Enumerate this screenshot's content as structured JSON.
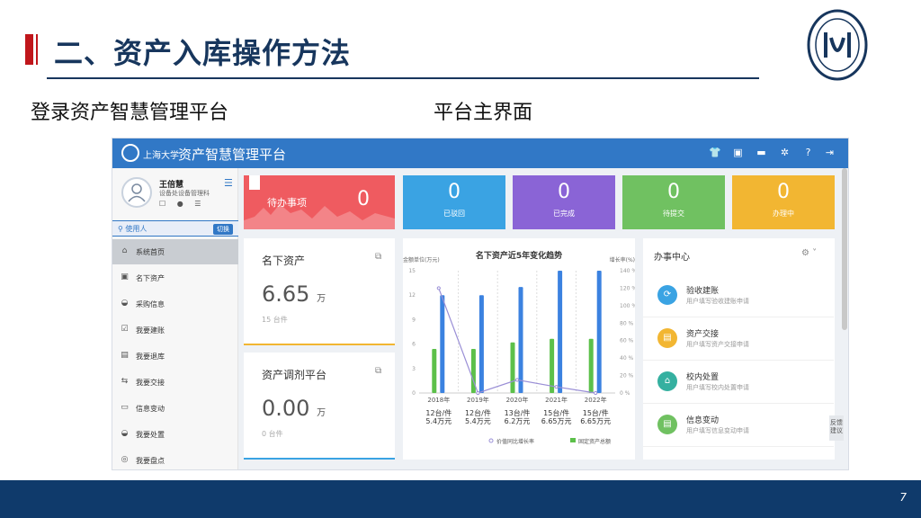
{
  "slide": {
    "title": "二、资产入库操作方法",
    "subtitle_left": "登录资产智慧管理平台",
    "subtitle_right": "平台主界面",
    "page_number": "7",
    "logo_text": "上海大学 SHANGHAI UNIVERSITY"
  },
  "app": {
    "brand": "上海大学",
    "title": "资产智慧管理平台",
    "top_icons": [
      "shirt-icon",
      "box-icon",
      "message-icon",
      "bug-icon",
      "help-icon",
      "logout-icon"
    ],
    "user": {
      "name": "王倍慧",
      "dept": "设备处设备管理科",
      "icons": "☐ ● ☰"
    },
    "role": {
      "label": "使用人",
      "switch": "切换"
    },
    "menu": [
      {
        "label": "系统首页",
        "icon": "⌂"
      },
      {
        "label": "名下资产",
        "icon": "▣"
      },
      {
        "label": "采购信息",
        "icon": "◒"
      },
      {
        "label": "我要建账",
        "icon": "☑"
      },
      {
        "label": "我要退库",
        "icon": "▤"
      },
      {
        "label": "我要交接",
        "icon": "⇆"
      },
      {
        "label": "信息变动",
        "icon": "▭"
      },
      {
        "label": "我要处置",
        "icon": "◒"
      },
      {
        "label": "我要盘点",
        "icon": "◎"
      }
    ],
    "todo": {
      "label": "待办事项",
      "value": "0"
    },
    "stats": [
      {
        "value": "0",
        "label": "已驳回",
        "color": "#3aa3e3"
      },
      {
        "value": "0",
        "label": "已完成",
        "color": "#8a64d6"
      },
      {
        "value": "0",
        "label": "待提交",
        "color": "#70c161"
      },
      {
        "value": "0",
        "label": "办理中",
        "color": "#f2b632"
      }
    ],
    "assets": {
      "title": "名下资产",
      "value": "6.65",
      "unit": "万",
      "count": "15 台件"
    },
    "transfer": {
      "title": "资产调剂平台",
      "value": "0.00",
      "unit": "万",
      "count": "0 台件"
    },
    "handle": {
      "title": "办事中心",
      "items": [
        {
          "title": "验收建账",
          "desc": "用户填写验收建账申请",
          "color": "#3aa3e3",
          "icon": "⟳"
        },
        {
          "title": "资产交接",
          "desc": "用户填写资产交接申请",
          "color": "#f2b632",
          "icon": "▤"
        },
        {
          "title": "校内处置",
          "desc": "用户填写校内处置申请",
          "color": "#35b0a0",
          "icon": "⌂"
        },
        {
          "title": "信息变动",
          "desc": "用户填写信息变动申请",
          "color": "#70c161",
          "icon": "▤"
        }
      ]
    },
    "feedback": "反馈建议"
  },
  "chart_data": {
    "type": "bar",
    "title": "名下资产近5年变化趋势",
    "y_left_label": "金额单位(万元)",
    "y_right_label": "增长率(%)",
    "categories": [
      "2018年",
      "2019年",
      "2020年",
      "2021年",
      "2022年"
    ],
    "y_left_ticks": [
      "0",
      "3",
      "6",
      "9",
      "12",
      "15"
    ],
    "y_right_ticks": [
      "0 %",
      "20 %",
      "40 %",
      "60 %",
      "80 %",
      "100 %",
      "120 %",
      "140 %"
    ],
    "ylim_left": [
      0,
      15
    ],
    "ylim_right": [
      0,
      140
    ],
    "series": [
      {
        "name": "固定资产总额",
        "values": [
          5.4,
          5.4,
          6.2,
          6.65,
          6.65
        ],
        "color": "#5cc04a"
      },
      {
        "values": [
          12,
          12,
          13,
          15,
          15
        ],
        "color": "#3b82e0"
      },
      {
        "name": "价值同比增长率",
        "values": [
          120,
          0,
          15,
          7,
          0
        ],
        "color": "#9a8fd6"
      }
    ],
    "data_labels": [
      [
        "12台/件",
        "5.4万元"
      ],
      [
        "12台/件",
        "5.4万元"
      ],
      [
        "13台/件",
        "6.2万元"
      ],
      [
        "15台/件",
        "6.65万元"
      ],
      [
        "15台/件",
        "6.65万元"
      ]
    ]
  }
}
